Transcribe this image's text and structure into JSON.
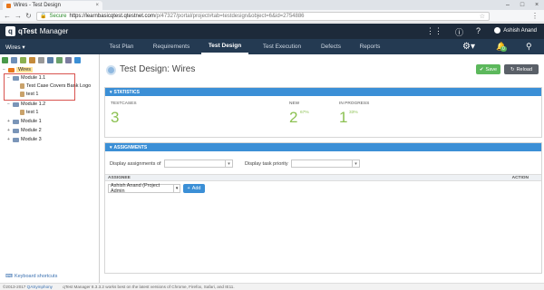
{
  "browser": {
    "tab_title": "Wires - Test Design",
    "tab_close": "×",
    "secure_label": "Secure",
    "url_domain": "https://learnbasicqtest.qtestnet.com",
    "url_path": "/p/47327/portal/project#tab=testdesign&object=6&id=2754886",
    "window_controls": [
      "–",
      "□",
      "×"
    ]
  },
  "app": {
    "logo": "q",
    "brand": "qTest",
    "product": "Manager",
    "user_name": "Ashish Anand",
    "project": "Wires ▾",
    "notification_count": "0"
  },
  "nav": {
    "tabs": [
      "Test Plan",
      "Requirements",
      "Test Design",
      "Test Execution",
      "Defects",
      "Reports"
    ],
    "active_tab": "Test Design"
  },
  "tree": {
    "root": "Wires",
    "items": [
      {
        "label": "Module 1.1",
        "type": "module"
      },
      {
        "label": "Test Case Covers Bank Logo",
        "type": "testcase"
      },
      {
        "label": "test 1",
        "type": "testcase"
      },
      {
        "label": "Module 1.2",
        "type": "module"
      },
      {
        "label": "test 1",
        "type": "testcase"
      },
      {
        "label": "Module 1",
        "type": "module"
      },
      {
        "label": "Module 2",
        "type": "module"
      },
      {
        "label": "Module 3",
        "type": "module"
      }
    ],
    "keyboard_shortcuts": "Keyboard shortcuts"
  },
  "page": {
    "title": "Test Design: Wires",
    "save_label": "Save",
    "reload_label": "Reload"
  },
  "statistics": {
    "header": "STATISTICS",
    "testcases_label": "TESTCASES",
    "testcases_value": "3",
    "new_label": "NEW",
    "new_value": "2",
    "new_pct": "67%",
    "inprogress_label": "IN PROGRESS",
    "inprogress_value": "1",
    "inprogress_pct": "33%"
  },
  "assignments": {
    "header": "ASSIGNMENTS",
    "display_assignments_label": "Display assignments of",
    "display_task_priority_label": "Display task priority",
    "col_assignee": "ASSIGNEE",
    "col_action": "ACTION",
    "assignee_value": "Ashish Anand (Project Admin",
    "add_label": "Add"
  },
  "footer": {
    "copyright": "©2013-2017",
    "company": "QASymphony",
    "notice": "qTest Manager 8.3.3.2 works best on the latest versions of Chrome, Firefox, Safari, and IE11."
  },
  "colors": {
    "header_bg": "#1d2a3a",
    "nav_bg": "#243a52",
    "accent_blue": "#3b8fd6",
    "stat_green": "#8cc152",
    "save_green": "#5cb85c",
    "highlight_red": "#d9534f"
  }
}
